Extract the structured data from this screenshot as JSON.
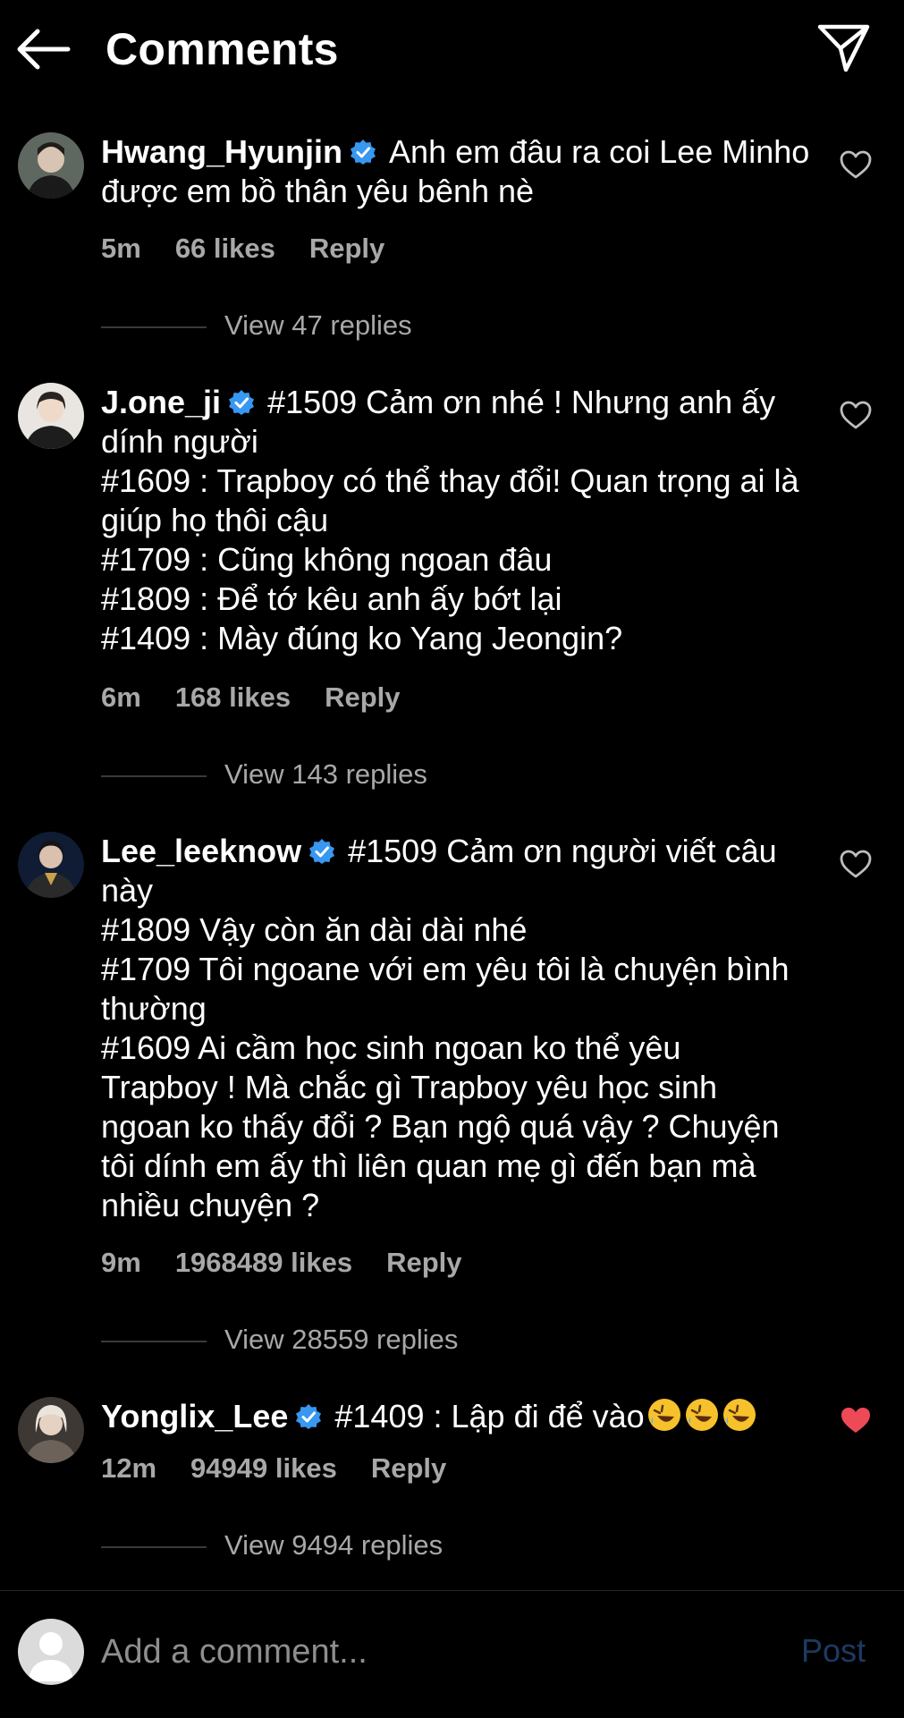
{
  "header": {
    "title": "Comments",
    "back_icon": "arrow-left-icon",
    "share_icon": "paper-plane-icon"
  },
  "comments": [
    {
      "username": "Hwang_Hyunjin",
      "verified": true,
      "lines": [
        "Anh em đâu ra coi Lee Minho",
        "được em bồ thân yêu bênh nè"
      ],
      "time": "5m",
      "likes": "66 likes",
      "reply": "Reply",
      "view_replies": "View 47 replies",
      "liked": false
    },
    {
      "username": "J.one_ji",
      "verified": true,
      "lines": [
        "#1509 Cảm ơn nhé ! Nhưng anh ấy",
        "dính người",
        "#1609 : Trapboy có thể thay đổi! Quan trọng ai là",
        "giúp họ thôi cậu",
        "#1709 : Cũng không ngoan đâu",
        "#1809 : Để tớ kêu anh ấy bớt lại",
        "#1409 : Mày đúng ko Yang Jeongin?"
      ],
      "time": "6m",
      "likes": "168 likes",
      "reply": "Reply",
      "view_replies": "View 143 replies",
      "liked": false
    },
    {
      "username": "Lee_leeknow",
      "verified": true,
      "lines": [
        "#1509 Cảm ơn người viết câu",
        "này",
        "#1809 Vậy còn ăn dài dài nhé",
        "#1709 Tôi ngoane với em yêu tôi là chuyện bình",
        "thường",
        "#1609 Ai cầm học sinh ngoan ko thể yêu",
        "Trapboy ! Mà chắc gì Trapboy yêu học sinh",
        "ngoan ko thấy đổi ? Bạn ngộ quá vậy ? Chuyện",
        "tôi dính em ấy thì liên quan mẹ gì đến bạn mà",
        "nhiều chuyện ?"
      ],
      "time": "9m",
      "likes": "1968489 likes",
      "reply": "Reply",
      "view_replies": "View 28559 replies",
      "liked": false
    },
    {
      "username": "Yonglix_Lee",
      "verified": true,
      "lines": [
        "#1409 : Lập đi để vào"
      ],
      "emoji": "rolling-on-floor-laughing-emoji",
      "time": "12m",
      "likes": "94949 likes",
      "reply": "Reply",
      "view_replies": "View 9494 replies",
      "liked": true
    }
  ],
  "composer": {
    "placeholder": "Add a comment...",
    "post_label": "Post"
  },
  "colors": {
    "background": "#000000",
    "meta_text": "#a8a8a8",
    "verified": "#3897f0",
    "like_red": "#ed4956",
    "post_disabled": "#1c3a63"
  }
}
